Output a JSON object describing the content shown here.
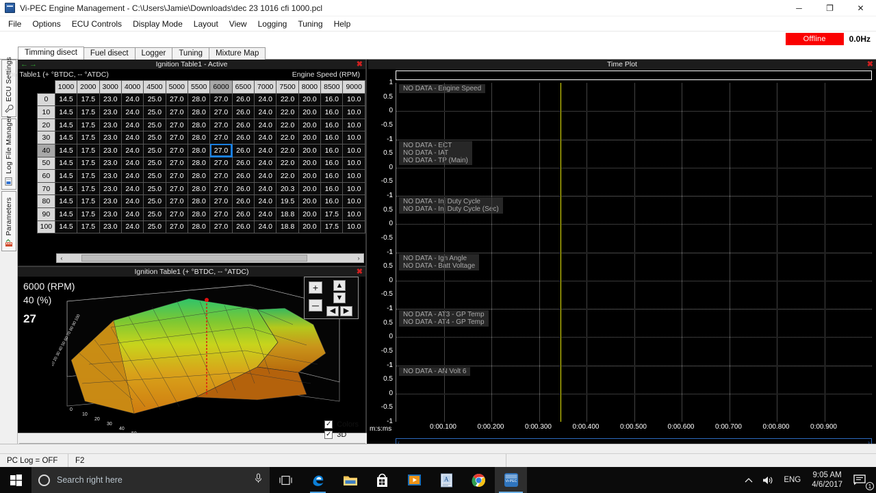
{
  "window": {
    "title": "Vi-PEC Engine Management - C:\\Users\\Jamie\\Downloads\\dec 23 1016 cfi 1000.pcl",
    "minimize": "─",
    "maximize": "❐",
    "close": "✕"
  },
  "menu": [
    "File",
    "Options",
    "ECU Controls",
    "Display Mode",
    "Layout",
    "View",
    "Logging",
    "Tuning",
    "Help"
  ],
  "connection": {
    "state": "Offline",
    "frequency": "0.0Hz",
    "state_color": "#fa0000"
  },
  "tabs": [
    {
      "label": "Timming disect",
      "active": true
    },
    {
      "label": "Fuel disect",
      "active": false
    },
    {
      "label": "Logger",
      "active": false
    },
    {
      "label": "Tuning",
      "active": false
    },
    {
      "label": "Mixture Map",
      "active": false
    }
  ],
  "sidebar": {
    "items": [
      {
        "label": "ECU Settings",
        "icon": "wrench-icon"
      },
      {
        "label": "Log File Manager",
        "icon": "log-file-icon"
      },
      {
        "label": "Parameters",
        "icon": "parameters-icon"
      }
    ]
  },
  "table_panel": {
    "title": "Ignition Table1 - Active",
    "subtitle_left": "on Table1 (+ °BTDC, -- °ATDC)",
    "subtitle_right": "Engine Speed (RPM)",
    "close": "✖",
    "nav_prev": "←",
    "nav_next": "→",
    "columns": [
      "1000",
      "2000",
      "3000",
      "4000",
      "4500",
      "5000",
      "5500",
      "6000",
      "6500",
      "7000",
      "7500",
      "8000",
      "8500",
      "9000"
    ],
    "rows": [
      "0",
      "10",
      "20",
      "30",
      "40",
      "50",
      "60",
      "70",
      "80",
      "90",
      "100"
    ],
    "selected_row": "40",
    "selected_column": "6000",
    "selected_value": "27.0",
    "values": [
      [
        "14.5",
        "17.5",
        "23.0",
        "24.0",
        "25.0",
        "27.0",
        "28.0",
        "27.0",
        "26.0",
        "24.0",
        "22.0",
        "20.0",
        "16.0",
        "10.0"
      ],
      [
        "14.5",
        "17.5",
        "23.0",
        "24.0",
        "25.0",
        "27.0",
        "28.0",
        "27.0",
        "26.0",
        "24.0",
        "22.0",
        "20.0",
        "16.0",
        "10.0"
      ],
      [
        "14.5",
        "17.5",
        "23.0",
        "24.0",
        "25.0",
        "27.0",
        "28.0",
        "27.0",
        "26.0",
        "24.0",
        "22.0",
        "20.0",
        "16.0",
        "10.0"
      ],
      [
        "14.5",
        "17.5",
        "23.0",
        "24.0",
        "25.0",
        "27.0",
        "28.0",
        "27.0",
        "26.0",
        "24.0",
        "22.0",
        "20.0",
        "16.0",
        "10.0"
      ],
      [
        "14.5",
        "17.5",
        "23.0",
        "24.0",
        "25.0",
        "27.0",
        "28.0",
        "27.0",
        "26.0",
        "24.0",
        "22.0",
        "20.0",
        "16.0",
        "10.0"
      ],
      [
        "14.5",
        "17.5",
        "23.0",
        "24.0",
        "25.0",
        "27.0",
        "28.0",
        "27.0",
        "26.0",
        "24.0",
        "22.0",
        "20.0",
        "16.0",
        "10.0"
      ],
      [
        "14.5",
        "17.5",
        "23.0",
        "24.0",
        "25.0",
        "27.0",
        "28.0",
        "27.0",
        "26.0",
        "24.0",
        "22.0",
        "20.0",
        "16.0",
        "10.0"
      ],
      [
        "14.5",
        "17.5",
        "23.0",
        "24.0",
        "25.0",
        "27.0",
        "28.0",
        "27.0",
        "26.0",
        "24.0",
        "20.3",
        "20.0",
        "16.0",
        "10.0"
      ],
      [
        "14.5",
        "17.5",
        "23.0",
        "24.0",
        "25.0",
        "27.0",
        "28.0",
        "27.0",
        "26.0",
        "24.0",
        "19.5",
        "20.0",
        "16.0",
        "10.0"
      ],
      [
        "14.5",
        "17.5",
        "23.0",
        "24.0",
        "25.0",
        "27.0",
        "28.0",
        "27.0",
        "26.0",
        "24.0",
        "18.8",
        "20.0",
        "17.5",
        "10.0"
      ],
      [
        "14.5",
        "17.5",
        "23.0",
        "24.0",
        "25.0",
        "27.0",
        "28.0",
        "27.0",
        "26.0",
        "24.0",
        "18.8",
        "20.0",
        "17.5",
        "10.0"
      ]
    ],
    "scroll_left": "‹",
    "scroll_right": "›"
  },
  "graph_panel": {
    "title": "Ignition Table1 (+ °BTDC, -- °ATDC)",
    "close": "✖",
    "rpm_readout": "6000 (RPM)",
    "load_readout": "40 (%)",
    "value_readout": "27",
    "controls": {
      "zoom_in": "+",
      "zoom_out": "─",
      "rotate_up": "▲",
      "rotate_down": "▼",
      "rotate_left": "◀",
      "rotate_right": "▶"
    },
    "options": [
      {
        "label": "Colors",
        "checked": true
      },
      {
        "label": "3D",
        "checked": true
      }
    ],
    "axis_ticks": [
      "0",
      "10",
      "20",
      "30",
      "40",
      "50",
      "60",
      "70"
    ],
    "scroll_left": "‹",
    "scroll_right": "›"
  },
  "time_plot": {
    "title": "Time Plot",
    "close": "✖",
    "time_axis_label": "m:s:ms",
    "y_ticks": [
      "1",
      "0.5",
      "0",
      "-0.5",
      "-1"
    ],
    "x_ticks": [
      "0:00.100",
      "0:00.200",
      "0:00.300",
      "0:00.400",
      "0:00.500",
      "0:00.600",
      "0:00.700",
      "0:00.800",
      "0:00.900"
    ],
    "cursor_color": "#e8e80a",
    "groups": [
      {
        "traces": [
          "NO DATA - Engine Speed"
        ]
      },
      {
        "traces": [
          "NO DATA - ECT",
          "NO DATA - IAT",
          "NO DATA - TP (Main)"
        ]
      },
      {
        "traces": [
          "NO DATA - Inj Duty Cycle",
          "NO DATA - Inj Duty Cycle (Sec)"
        ]
      },
      {
        "traces": [
          "NO DATA - Ign Angle",
          "NO DATA - Batt Voltage"
        ]
      },
      {
        "traces": [
          "NO DATA - AT3 - GP Temp",
          "NO DATA - AT4 - GP Temp"
        ]
      },
      {
        "traces": [
          "NO DATA - AN Volt 6"
        ]
      }
    ],
    "scroll_left": "‹",
    "scroll_right": "›"
  },
  "statusbar": {
    "pc_log": "PC Log = OFF",
    "hint": "F2"
  },
  "taskbar": {
    "search_placeholder": "Search right here",
    "apps": [
      {
        "name": "task-view",
        "running": false
      },
      {
        "name": "edge",
        "running": true
      },
      {
        "name": "file-explorer",
        "running": false
      },
      {
        "name": "microsoft-store",
        "running": false
      },
      {
        "name": "movies-tv",
        "running": false
      },
      {
        "name": "document-app",
        "running": false
      },
      {
        "name": "chrome",
        "running": false
      },
      {
        "name": "vipec",
        "running": true,
        "label": "Vi-PEC",
        "active": true
      }
    ],
    "tray": {
      "language": "ENG",
      "time": "9:05 AM",
      "date": "4/6/2017",
      "notification_count": "1"
    }
  }
}
